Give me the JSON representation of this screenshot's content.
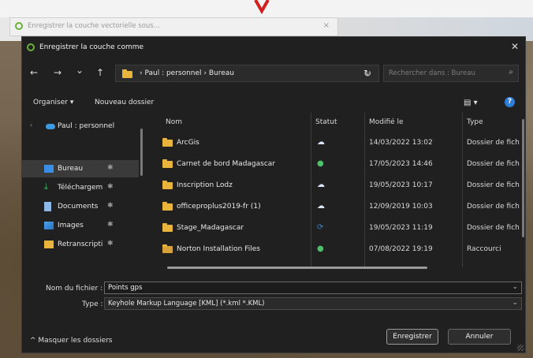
{
  "back_window": {
    "title": "Enregistrer la couche vectorielle sous...",
    "close": "×"
  },
  "dialog": {
    "title": "Enregistrer la couche comme",
    "close": "✕",
    "nav": {
      "back": "←",
      "forward": "→",
      "history": "⌄",
      "up": "↑",
      "path": "› Paul : personnel › Bureau",
      "refresh": "↻",
      "search_placeholder": "Rechercher dans : Bureau",
      "search_icon": "⌕"
    },
    "toolbar": {
      "organize": "Organiser ▾",
      "new_folder": "Nouveau dossier",
      "view": "▤ ▾",
      "help": "?"
    },
    "sidebar": {
      "items": [
        {
          "label": "Paul : personnel",
          "icon": "cloud-icon",
          "pin": ""
        },
        {
          "label": "Bureau",
          "icon": "desktop-icon",
          "pin": "✱"
        },
        {
          "label": "Téléchargem",
          "icon": "download-icon",
          "pin": "✱"
        },
        {
          "label": "Documents",
          "icon": "documents-icon",
          "pin": "✱"
        },
        {
          "label": "Images",
          "icon": "images-icon",
          "pin": "✱"
        },
        {
          "label": "Retranscripti",
          "icon": "folder-icon",
          "pin": "✱"
        }
      ]
    },
    "columns": {
      "name": "Nom",
      "status": "Statut",
      "modified": "Modifié le",
      "type": "Type"
    },
    "files": [
      {
        "name": "ArcGis",
        "status": "cloud",
        "modified": "14/03/2022 13:02",
        "type": "Dossier de fich",
        "icon": "folder-icon"
      },
      {
        "name": "Carnet de bord Madagascar",
        "status": "synced",
        "modified": "17/05/2023 14:46",
        "type": "Dossier de fich",
        "icon": "folder-icon"
      },
      {
        "name": "Inscription Lodz",
        "status": "cloud",
        "modified": "19/05/2023 10:17",
        "type": "Dossier de fich",
        "icon": "folder-icon"
      },
      {
        "name": "officeproplus2019-fr (1)",
        "status": "cloud",
        "modified": "12/09/2019 10:03",
        "type": "Dossier de fich",
        "icon": "folder-icon"
      },
      {
        "name": "Stage_Madagascar",
        "status": "syncing",
        "modified": "19/05/2023 11:19",
        "type": "Dossier de fich",
        "icon": "folder-icon"
      },
      {
        "name": "Norton Installation Files",
        "status": "synced",
        "modified": "07/08/2022 19:19",
        "type": "Raccourci",
        "icon": "shortcut-folder-icon"
      }
    ],
    "form": {
      "filename_label": "Nom du fichier :",
      "filename_value": "Points gps",
      "type_label": "Type :",
      "type_value": "Keyhole Markup Language [KML] (*.kml *.KML)"
    },
    "footer": {
      "hide_folders": "^ Masquer les dossiers",
      "save": "Enregistrer",
      "cancel": "Annuler"
    }
  }
}
